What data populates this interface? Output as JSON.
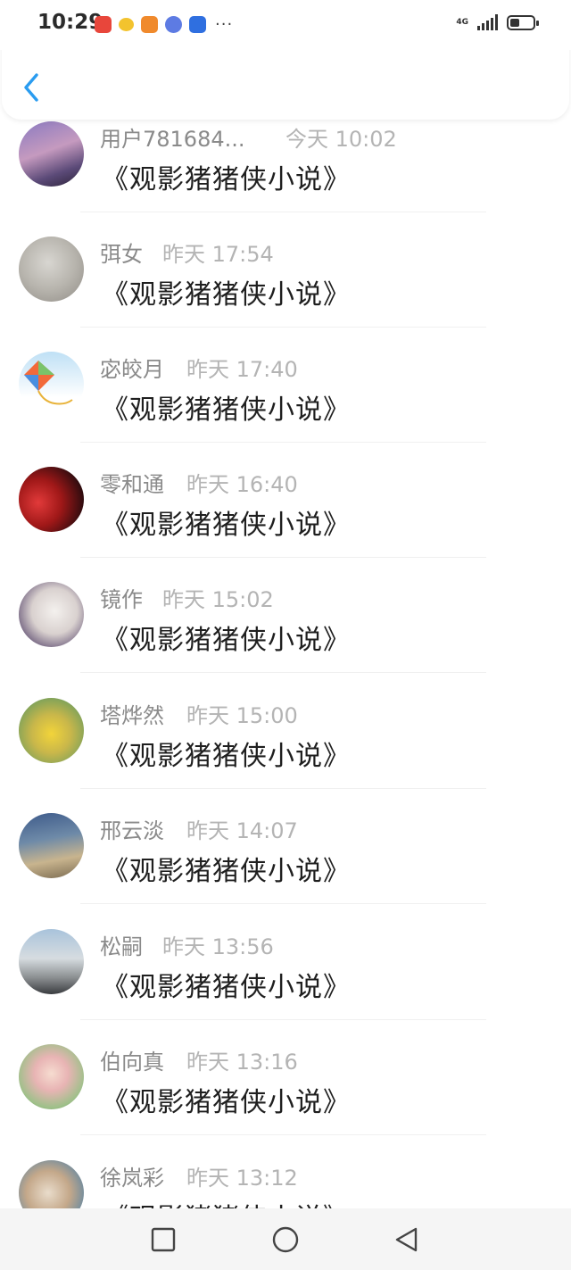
{
  "status_bar": {
    "time": "10:29",
    "network": "4G",
    "notification_icons": [
      "huawei-app-icon",
      "wechat-icon",
      "game-icon",
      "music-icon",
      "bulb-icon"
    ],
    "more": "···"
  },
  "header": {
    "back_icon": "chevron-left-icon"
  },
  "colors": {
    "accent": "#2a9cf0",
    "name_text": "#8a8a8a",
    "time_text": "#b4b4b4",
    "message_text": "#1f1f1f"
  },
  "messages": [
    {
      "name": "用户781684...",
      "time": "今天 10:02",
      "text": "《观影猪猪侠小说》"
    },
    {
      "name": "弭女",
      "time": "昨天 17:54",
      "text": "《观影猪猪侠小说》"
    },
    {
      "name": "宓皎月",
      "time": "昨天 17:40",
      "text": "《观影猪猪侠小说》"
    },
    {
      "name": "零和通",
      "time": "昨天 16:40",
      "text": "《观影猪猪侠小说》"
    },
    {
      "name": "镜作",
      "time": "昨天 15:02",
      "text": "《观影猪猪侠小说》"
    },
    {
      "name": "塔烨然",
      "time": "昨天 15:00",
      "text": "《观影猪猪侠小说》"
    },
    {
      "name": "邢云淡",
      "time": "昨天 14:07",
      "text": "《观影猪猪侠小说》"
    },
    {
      "name": "松嗣",
      "time": "昨天 13:56",
      "text": "《观影猪猪侠小说》"
    },
    {
      "name": "伯向真",
      "time": "昨天 13:16",
      "text": "《观影猪猪侠小说》"
    },
    {
      "name": "徐岚彩",
      "time": "昨天 13:12",
      "text": "《观影猪猪侠小说》"
    }
  ],
  "bottom_nav": {
    "icons": [
      "recent-apps-icon",
      "home-icon",
      "back-triangle-icon"
    ]
  }
}
